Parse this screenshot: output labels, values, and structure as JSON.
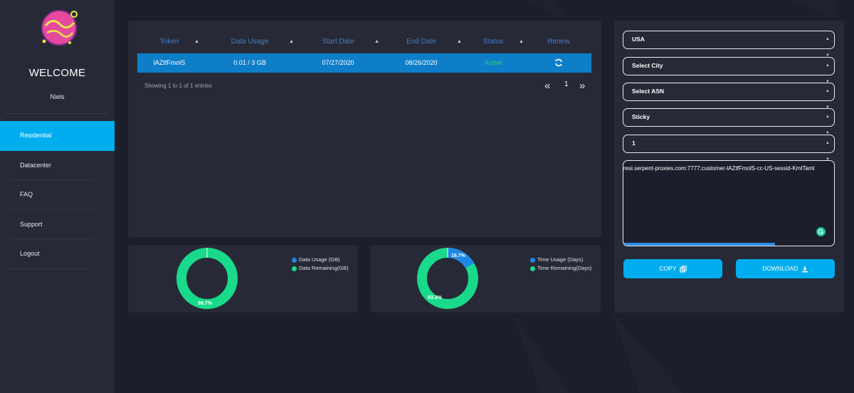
{
  "sidebar": {
    "welcome": "WELCOME",
    "username": "Niels",
    "items": [
      {
        "label": "Residential",
        "active": true
      },
      {
        "label": "Datacenter",
        "active": false
      },
      {
        "label": "FAQ",
        "active": false
      },
      {
        "label": "Support",
        "active": false
      },
      {
        "label": "Logout",
        "active": false
      }
    ]
  },
  "table": {
    "columns": [
      "Token",
      "Data Usage",
      "Start Date",
      "End Date",
      "Status",
      "Renew"
    ],
    "rows": [
      {
        "token": "lAZtfFmolS",
        "data_usage": "0.01 / 3 GB",
        "start_date": "07/27/2020",
        "end_date": "08/26/2020",
        "status": "Active",
        "renew_icon": "refresh-icon"
      }
    ],
    "showing": "Showing 1 to 1 of 1 entries",
    "page": "1"
  },
  "data_chart": {
    "legend": [
      "Data Usage (GB)",
      "Data Remaining(GB)"
    ],
    "usage_label": "",
    "remaining_label": "99.7%",
    "usage_fraction": 0.003,
    "colors": {
      "usage": "#1e88e5",
      "remaining": "#19d98b"
    }
  },
  "time_chart": {
    "legend": [
      "Time Usage (Days)",
      "Time Remaining(Days)"
    ],
    "usage_label": "16.7%",
    "remaining_label": "83.3%",
    "usage_fraction": 0.167,
    "colors": {
      "usage": "#1e88e5",
      "remaining": "#19d98b"
    }
  },
  "form": {
    "country": "USA",
    "city": "Select City",
    "asn": "Select ASN",
    "session": "Sticky",
    "count": "1",
    "proxy_output": "resi.serpent-proxies.com:7777:customer-lAZtfFmolS-cc-US-sessid-KmITaml",
    "progress": 0.72,
    "copy_label": "COPY",
    "download_label": "DOWNLOAD"
  },
  "colors": {
    "accent": "#00aeef",
    "active_row": "#0f7ec8",
    "status_active": "#22d47a",
    "header_text": "#3f7ec7"
  }
}
